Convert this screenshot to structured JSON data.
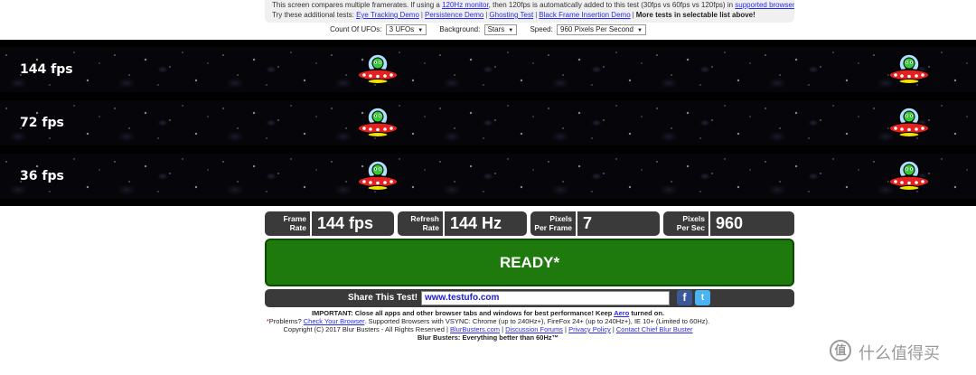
{
  "info": {
    "line1_pre": "This screen compares multiple framerates. If using a ",
    "line1_link1": "120Hz monitor",
    "line1_mid": ", then 120fps is automatically added to this test (30fps vs 60fps vs 120fps) in ",
    "line1_link2": "supported browsers",
    "line2_pre": "Try these additional tests: ",
    "links": [
      "Eye Tracking Demo",
      "Persistence Demo",
      "Ghosting Test",
      "Black Frame Insertion Demo"
    ],
    "separator": "|",
    "line2_post": "More tests in selectable list above!"
  },
  "controls": {
    "count_label": "Count Of UFOs:",
    "count_value": "3 UFOs",
    "background_label": "Background:",
    "background_value": "Stars",
    "speed_label": "Speed:",
    "speed_value": "960 Pixels Per Second",
    "dropdown_arrow": "▼"
  },
  "strips": [
    {
      "label": "144 fps"
    },
    {
      "label": "72 fps"
    },
    {
      "label": "36 fps"
    }
  ],
  "stats": {
    "frame_rate_k1": "Frame",
    "frame_rate_k2": "Rate",
    "frame_rate_v": "144 fps",
    "refresh_rate_k1": "Refresh",
    "refresh_rate_k2": "Rate",
    "refresh_rate_v": "144 Hz",
    "ppf_k1": "Pixels",
    "ppf_k2": "Per Frame",
    "ppf_v": "7",
    "pps_k1": "Pixels",
    "pps_k2": "Per Sec",
    "pps_v": "960"
  },
  "ready_label": "READY*",
  "share": {
    "label": "Share This Test!",
    "url": "www.testufo.com",
    "fb_icon": "f",
    "tw_icon": "t"
  },
  "footer": {
    "important_pre": "IMPORTANT: Close all apps and other browser tabs and windows for best performance! Keep ",
    "aero_link": "Aero",
    "important_post": " turned on.",
    "problems_star": "*",
    "problems_pre": "Problems? ",
    "check_link": "Check Your Browser",
    "problems_post": ". Supported Browsers with VSYNC: Chrome (up to 240Hz+), FireFox 24+ (up to 240Hz+), IE 10+ (Limited to 60Hz).",
    "copyright": "Copyright (C) 2017 Blur Busters - All Rights Reserved | ",
    "links": [
      "BlurBusters.com",
      "Discussion Forums",
      "Privacy Policy",
      "Contact Chief Blur Buster"
    ],
    "tagline": "Blur Busters: Everything better than 60Hz™"
  },
  "watermark": {
    "icon": "值",
    "text": "什么值得买"
  },
  "colors": {
    "ready_green": "#1e7a0c",
    "stat_box": "#3a3a3a",
    "link_blue": "#2a2aee"
  }
}
